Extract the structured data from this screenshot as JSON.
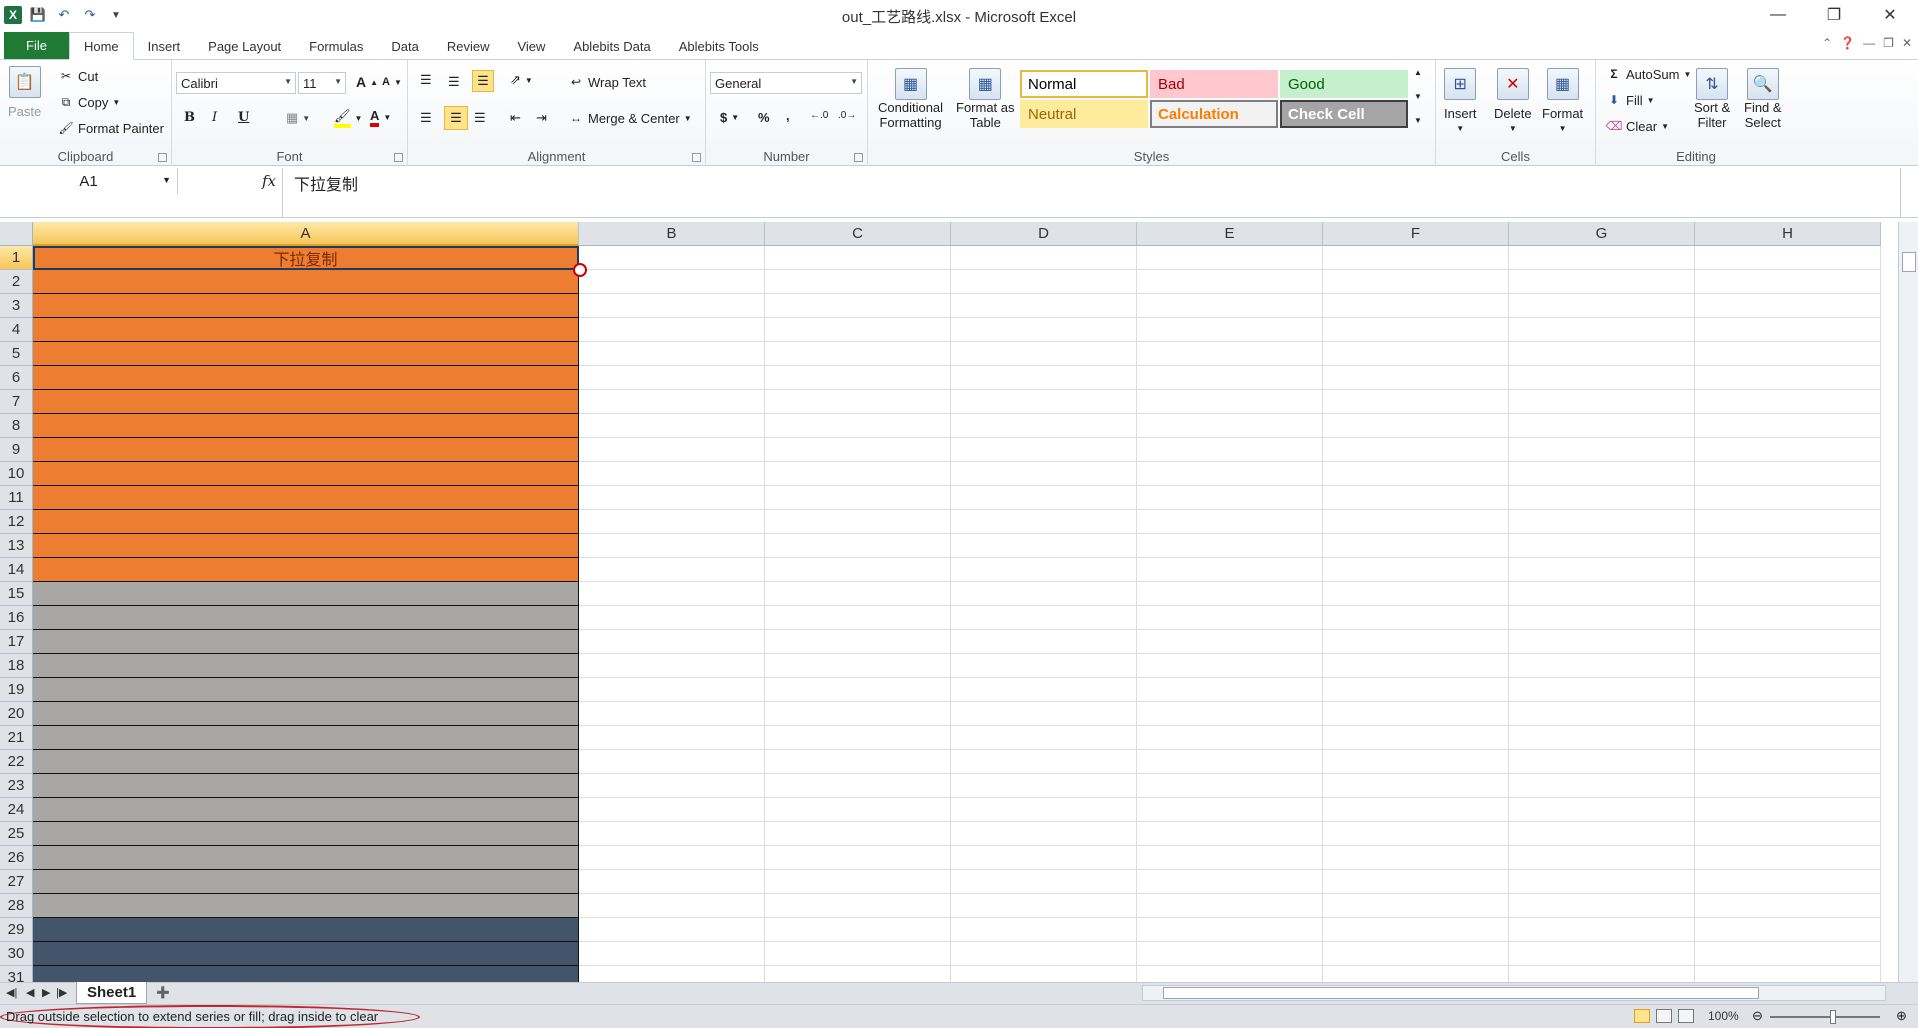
{
  "title": "out_工艺路线.xlsx - Microsoft Excel",
  "tabs": [
    "File",
    "Home",
    "Insert",
    "Page Layout",
    "Formulas",
    "Data",
    "Review",
    "View",
    "Ablebits Data",
    "Ablebits Tools"
  ],
  "active_tab": "Home",
  "clipboard": {
    "paste": "Paste",
    "cut": "Cut",
    "copy": "Copy",
    "format_painter": "Format Painter",
    "label": "Clipboard"
  },
  "font": {
    "name": "Calibri",
    "size": "11",
    "label": "Font",
    "bold": "B",
    "italic": "I",
    "underline": "U",
    "grow": "A",
    "shrink": "A",
    "font_color": "A"
  },
  "alignment": {
    "wrap_text": "Wrap Text",
    "merge_center": "Merge & Center",
    "label": "Alignment"
  },
  "number": {
    "format": "General",
    "label": "Number",
    "currency": "$",
    "percent": "%",
    "comma": ","
  },
  "styles_group": {
    "conditional": [
      "Conditional",
      "Formatting"
    ],
    "format_table": [
      "Format as",
      "Table"
    ],
    "label": "Styles",
    "items": [
      {
        "name": "Normal",
        "bg": "#ffffff",
        "fg": "#000000",
        "border": "#e8b93c"
      },
      {
        "name": "Bad",
        "bg": "#ffc7ce",
        "fg": "#9c0006",
        "border": "#ffc7ce"
      },
      {
        "name": "Good",
        "bg": "#c6efce",
        "fg": "#006100",
        "border": "#c6efce"
      },
      {
        "name": "Neutral",
        "bg": "#ffeb9c",
        "fg": "#9c6500",
        "border": "#ffeb9c"
      },
      {
        "name": "Calculation",
        "bg": "#f2f2f2",
        "fg": "#fa7d00",
        "border": "#7f7f7f"
      },
      {
        "name": "Check Cell",
        "bg": "#a5a5a5",
        "fg": "#ffffff",
        "border": "#3f3f3f"
      }
    ]
  },
  "cells_group": {
    "insert": "Insert",
    "delete": "Delete",
    "format": "Format",
    "label": "Cells"
  },
  "editing": {
    "autosum": "AutoSum",
    "fill": "Fill",
    "clear": "Clear",
    "sort": [
      "Sort &",
      "Filter"
    ],
    "find": [
      "Find &",
      "Select"
    ],
    "label": "Editing"
  },
  "formula_bar": {
    "name_box": "A1",
    "fx": "fx",
    "content": "下拉复制"
  },
  "columns": [
    "A",
    "B",
    "C",
    "D",
    "E",
    "F",
    "G",
    "H"
  ],
  "selected_column": "A",
  "rows": [
    "1",
    "2",
    "3",
    "4",
    "5",
    "6",
    "7",
    "8",
    "9",
    "10",
    "11",
    "12",
    "13",
    "14",
    "15",
    "16",
    "17",
    "18",
    "19",
    "20",
    "21",
    "22",
    "23",
    "24",
    "25",
    "26",
    "27",
    "28",
    "29",
    "30",
    "31"
  ],
  "cell_A1": "下拉复制",
  "band_colors": {
    "orange": "#ed7d31",
    "gray": "#a9a6a6",
    "navy": "#44546a"
  },
  "band_ranges": {
    "orange": [
      1,
      14
    ],
    "gray": [
      15,
      28
    ],
    "navy": [
      29,
      31
    ]
  },
  "sheet_tab": "Sheet1",
  "status": {
    "message": "Drag outside selection to extend series or fill; drag inside to clear",
    "zoom": "100%"
  }
}
